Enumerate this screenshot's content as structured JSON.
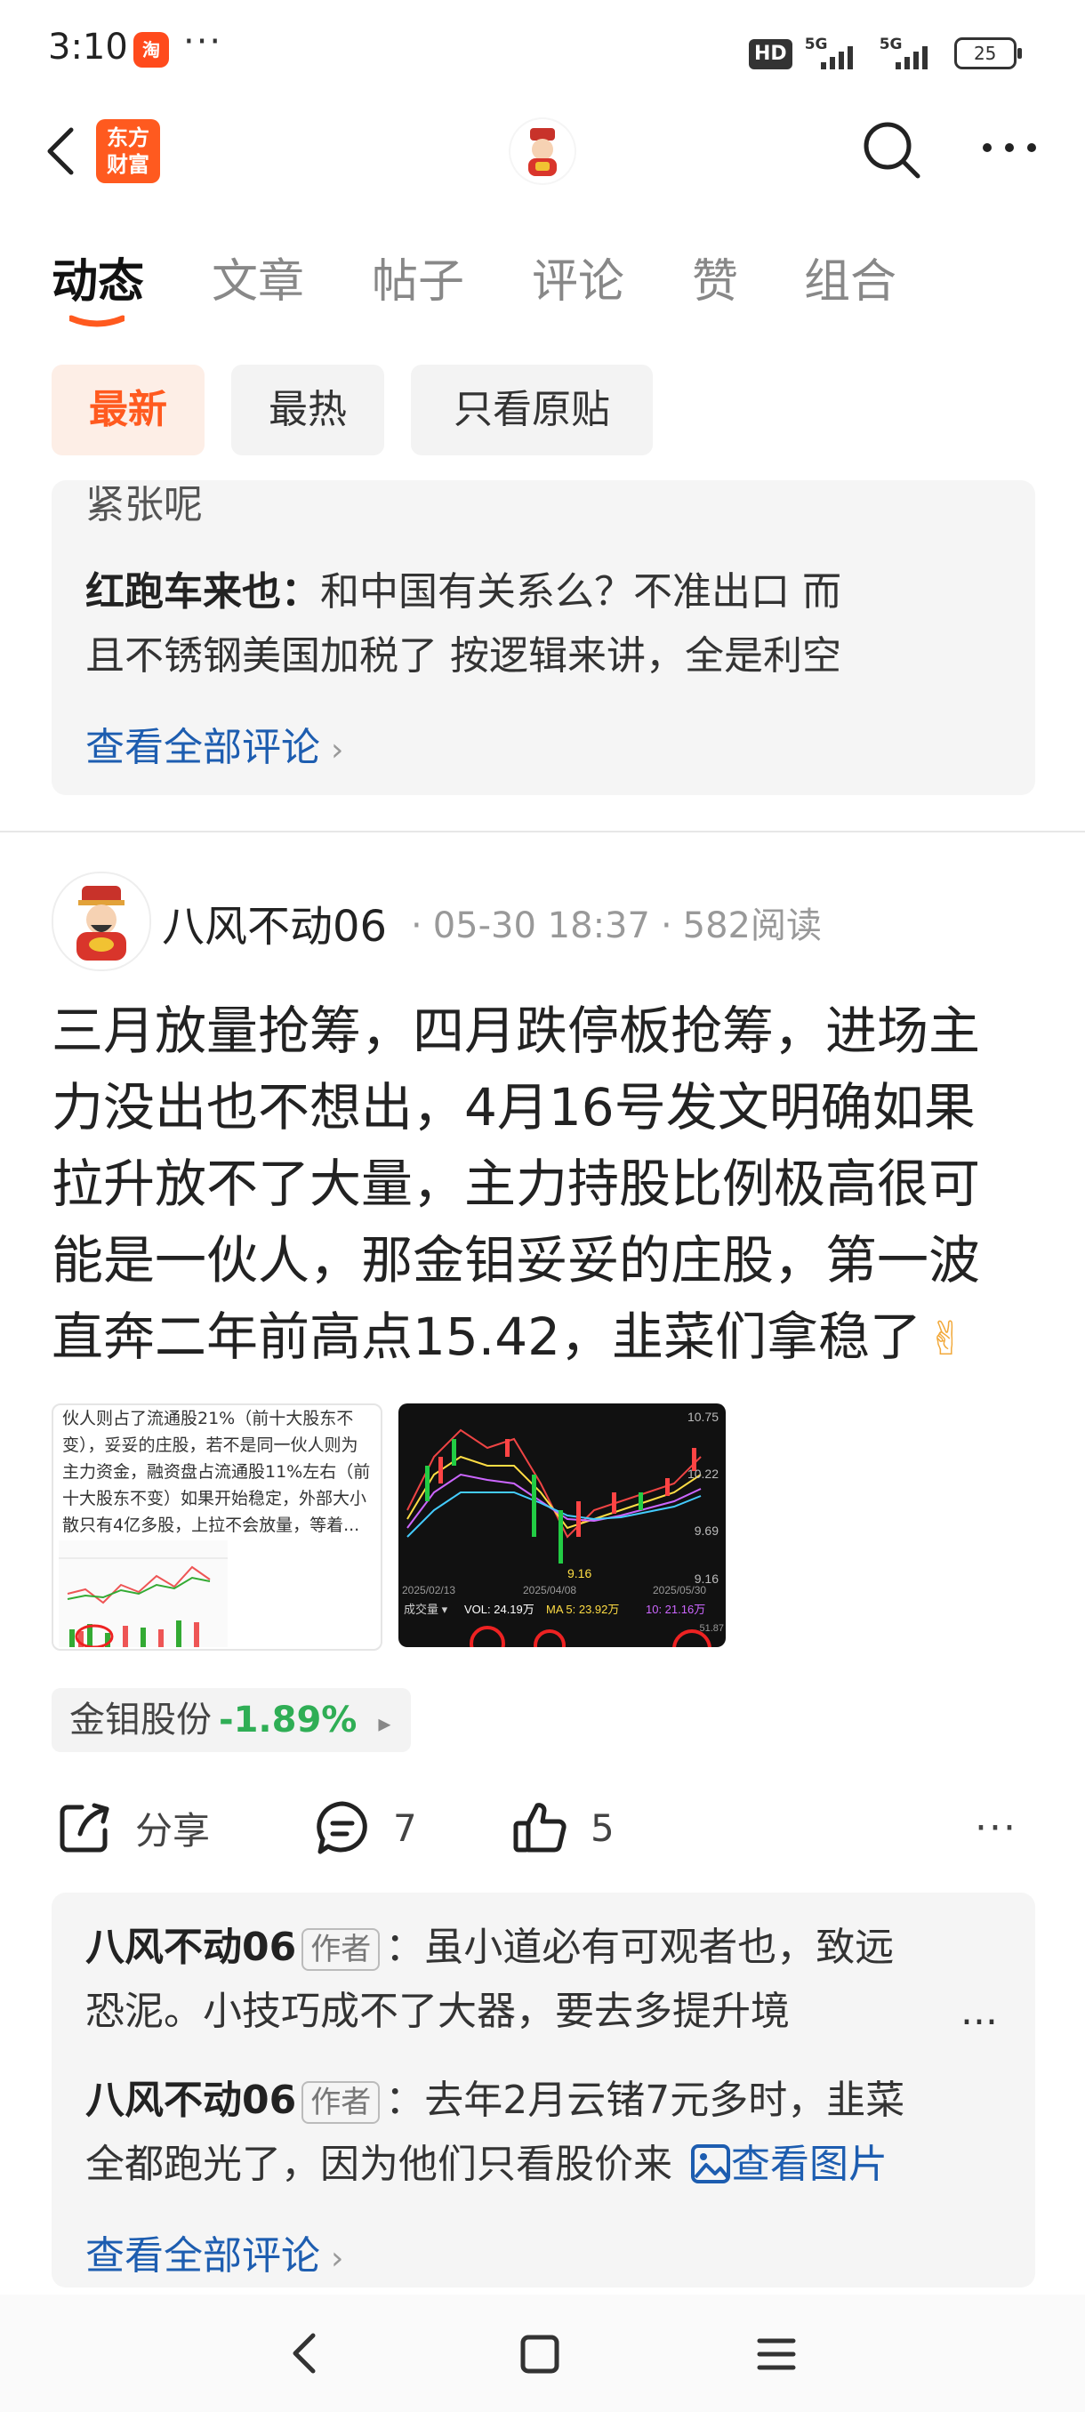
{
  "status": {
    "time": "3:10",
    "taobao_badge": "淘",
    "more": "···",
    "hd": "HD",
    "signal1": "5G",
    "signal2": "5G",
    "battery": "25"
  },
  "app": {
    "logo_text_1": "东方",
    "logo_text_2": "财富"
  },
  "tabs": [
    {
      "label": "动态"
    },
    {
      "label": "文章"
    },
    {
      "label": "帖子"
    },
    {
      "label": "评论"
    },
    {
      "label": "赞"
    },
    {
      "label": "组合"
    }
  ],
  "filters": [
    {
      "label": "最新"
    },
    {
      "label": "最热"
    },
    {
      "label": "只看原贴"
    }
  ],
  "prev_comments": {
    "partial_text": "紧张呢",
    "comment_name": "红跑车来也：",
    "comment_text_line1": "和中国有关系么？不准出口  而",
    "comment_text_line2": "且不锈钢美国加税了  按逻辑来讲，全是利空",
    "see_all": "查看全部评论"
  },
  "post": {
    "author": "八风不动06",
    "time": "05-30 18:37",
    "reads": "582阅读",
    "body_lines": [
      "三月放量抢筹，四月跌停板抢筹，进场主",
      "力没出也不想出，4月16号发文明确如果",
      "拉升放不了大量，主力持股比例极高很可",
      "能是一伙人，那金钼妥妥的庄股，第一波",
      "直奔二年前高点15.42，韭菜们拿稳了"
    ],
    "emoji": "✌",
    "image1_lines": [
      "伙人则占了流通股21%（前十大股东不",
      "变），妥妥的庄股，若不是同一伙人则为",
      "主力资金，融资盘占流通股11%左右（前",
      "十大股东不变）如果开始稳定，外部大小",
      "散只有4亿多股，上拉不会放量，等着..."
    ],
    "image2": {
      "price_labels": [
        "10.75",
        "10.22",
        "9.69",
        "9.16"
      ],
      "low_label": "9.16",
      "dates": [
        "2025/02/13",
        "2025/04/08",
        "2025/05/30"
      ],
      "vol_bar": "成交量 ▾",
      "vol_text": "VOL: 24.19万",
      "ma5_text": "MA 5: 23.92万",
      "ma10_text": "10: 21.16万",
      "side_val": "51.87"
    },
    "stock": {
      "name": "金钼股份",
      "pct": "-1.89%",
      "arrow": "▸"
    },
    "actions": {
      "share": "分享",
      "comments": "7",
      "likes": "5",
      "more": "···"
    },
    "comments": [
      {
        "name": "八风不动06",
        "tag": "作者",
        "colon": "：",
        "line1": "虽小道必有可观者也，致远",
        "line2": "恐泥。小技巧成不了大器，要去多提升境",
        "ellipsis": "..."
      },
      {
        "name": "八风不动06",
        "tag": "作者",
        "colon": "：",
        "line1": "去年2月云锗7元多时，韭菜",
        "line2": "全都跑光了，因为他们只看股价来",
        "view_pic": "查看图片"
      }
    ],
    "see_all": "查看全部评论"
  },
  "colors": {
    "accent": "#ff5a1f",
    "link": "#1d5db0",
    "down_green": "#2fae55"
  }
}
